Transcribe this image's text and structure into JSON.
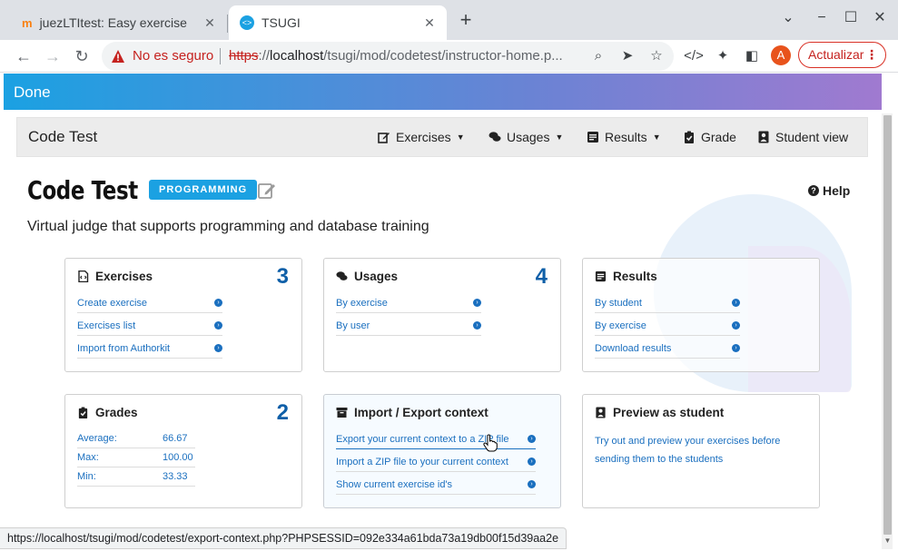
{
  "browser": {
    "tabs": [
      {
        "title": "juezLTItest: Easy exercise",
        "favicon": "moodle-icon"
      },
      {
        "title": "TSUGI",
        "favicon": "code-icon"
      }
    ],
    "security_label": "No es seguro",
    "url_scheme": "https",
    "url_sep": "://",
    "url_host": "localhost",
    "url_path": "/tsugi/mod/codetest/instructor-home.p...",
    "profile_initial": "A",
    "update_label": "Actualizar",
    "status_url": "https://localhost/tsugi/mod/codetest/export-context.php?PHPSESSID=092e334a61bda73a19db00f15d39aa2e"
  },
  "done_bar": {
    "label": "Done"
  },
  "navbar": {
    "brand": "Code Test",
    "items": [
      {
        "label": "Exercises",
        "icon": "edit-icon",
        "dropdown": true
      },
      {
        "label": "Usages",
        "icon": "comments-icon",
        "dropdown": true
      },
      {
        "label": "Results",
        "icon": "list-icon",
        "dropdown": true
      },
      {
        "label": "Grade",
        "icon": "clipboard-check-icon",
        "dropdown": false
      },
      {
        "label": "Student view",
        "icon": "user-icon",
        "dropdown": false
      }
    ]
  },
  "header": {
    "title": "Code Test",
    "badge": "PROGRAMMING",
    "help": "Help",
    "subtitle": "Virtual judge that supports programming and database training"
  },
  "cards": {
    "exercises": {
      "title": "Exercises",
      "count": "3",
      "links": [
        "Create exercise",
        "Exercises list",
        "Import from Authorkit"
      ]
    },
    "usages": {
      "title": "Usages",
      "count": "4",
      "links": [
        "By exercise",
        "By user"
      ]
    },
    "results": {
      "title": "Results",
      "links": [
        "By student",
        "By exercise",
        "Download results"
      ]
    },
    "grades": {
      "title": "Grades",
      "count": "2",
      "rows": [
        {
          "label": "Average:",
          "value": "66.67"
        },
        {
          "label": "Max:",
          "value": "100.00"
        },
        {
          "label": "Min:",
          "value": "33.33"
        }
      ]
    },
    "import_export": {
      "title": "Import / Export context",
      "links": [
        "Export your current context to a ZIP file",
        "Import a ZIP file to your current context",
        "Show current exercise id's"
      ]
    },
    "preview": {
      "title": "Preview as student",
      "text": "Try out and preview your exercises before sending them to the students"
    }
  },
  "colors": {
    "accent": "#1ba1e2",
    "link": "#1a6fbf",
    "count": "#0e5fa8",
    "gradient_end": "#a07ad0"
  }
}
